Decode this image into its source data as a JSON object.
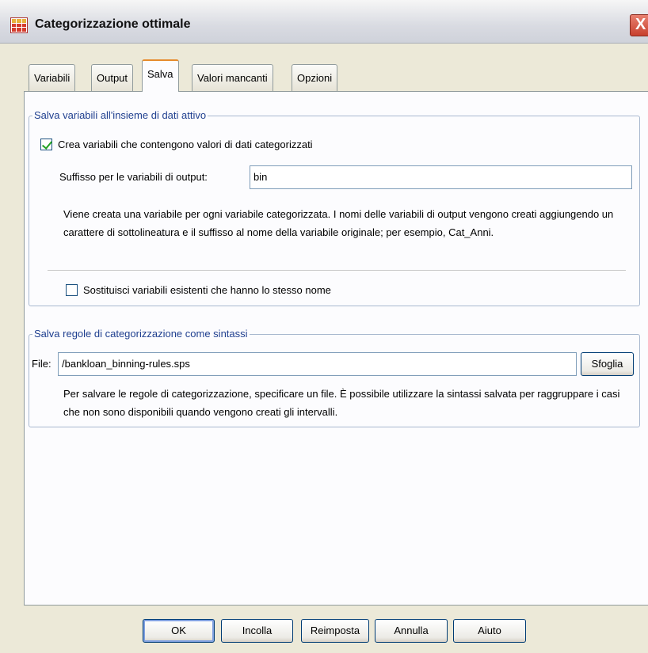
{
  "window": {
    "title": "Categorizzazione ottimale",
    "close_glyph": "X"
  },
  "tabs": [
    {
      "label": "Variabili"
    },
    {
      "label": "Output"
    },
    {
      "label": "Salva"
    },
    {
      "label": "Valori mancanti"
    },
    {
      "label": "Opzioni"
    }
  ],
  "save_variables": {
    "legend": "Salva variabili all'insieme di dati attivo",
    "create_checkbox": {
      "label": "Crea variabili che contengono valori di dati categorizzati",
      "checked": true
    },
    "suffix_label": "Suffisso per le variabili di output:",
    "suffix_value": "bin",
    "help_text": "Viene creata una variabile per ogni variabile categorizzata. I nomi delle variabili di output vengono creati aggiungendo un carattere di sottolineatura e il suffisso al nome della variabile originale; per esempio, Cat_Anni.",
    "replace_checkbox": {
      "label": "Sostituisci variabili esistenti che hanno lo stesso nome",
      "checked": false
    }
  },
  "save_rules": {
    "legend": "Salva regole di categorizzazione come sintassi",
    "file_label": "File:",
    "file_value": "/bankloan_binning-rules.sps",
    "browse_label": "Sfoglia",
    "help_text": "Per salvare le regole di categorizzazione, specificare un file. È possibile utilizzare la sintassi salvata per raggruppare i casi che non sono disponibili quando vengono creati gli intervalli."
  },
  "buttons": {
    "ok": "OK",
    "paste": "Incolla",
    "reset": "Reimposta",
    "cancel": "Annulla",
    "help": "Aiuto"
  },
  "icons": {
    "app": "spss-table-icon",
    "close": "close-icon"
  }
}
